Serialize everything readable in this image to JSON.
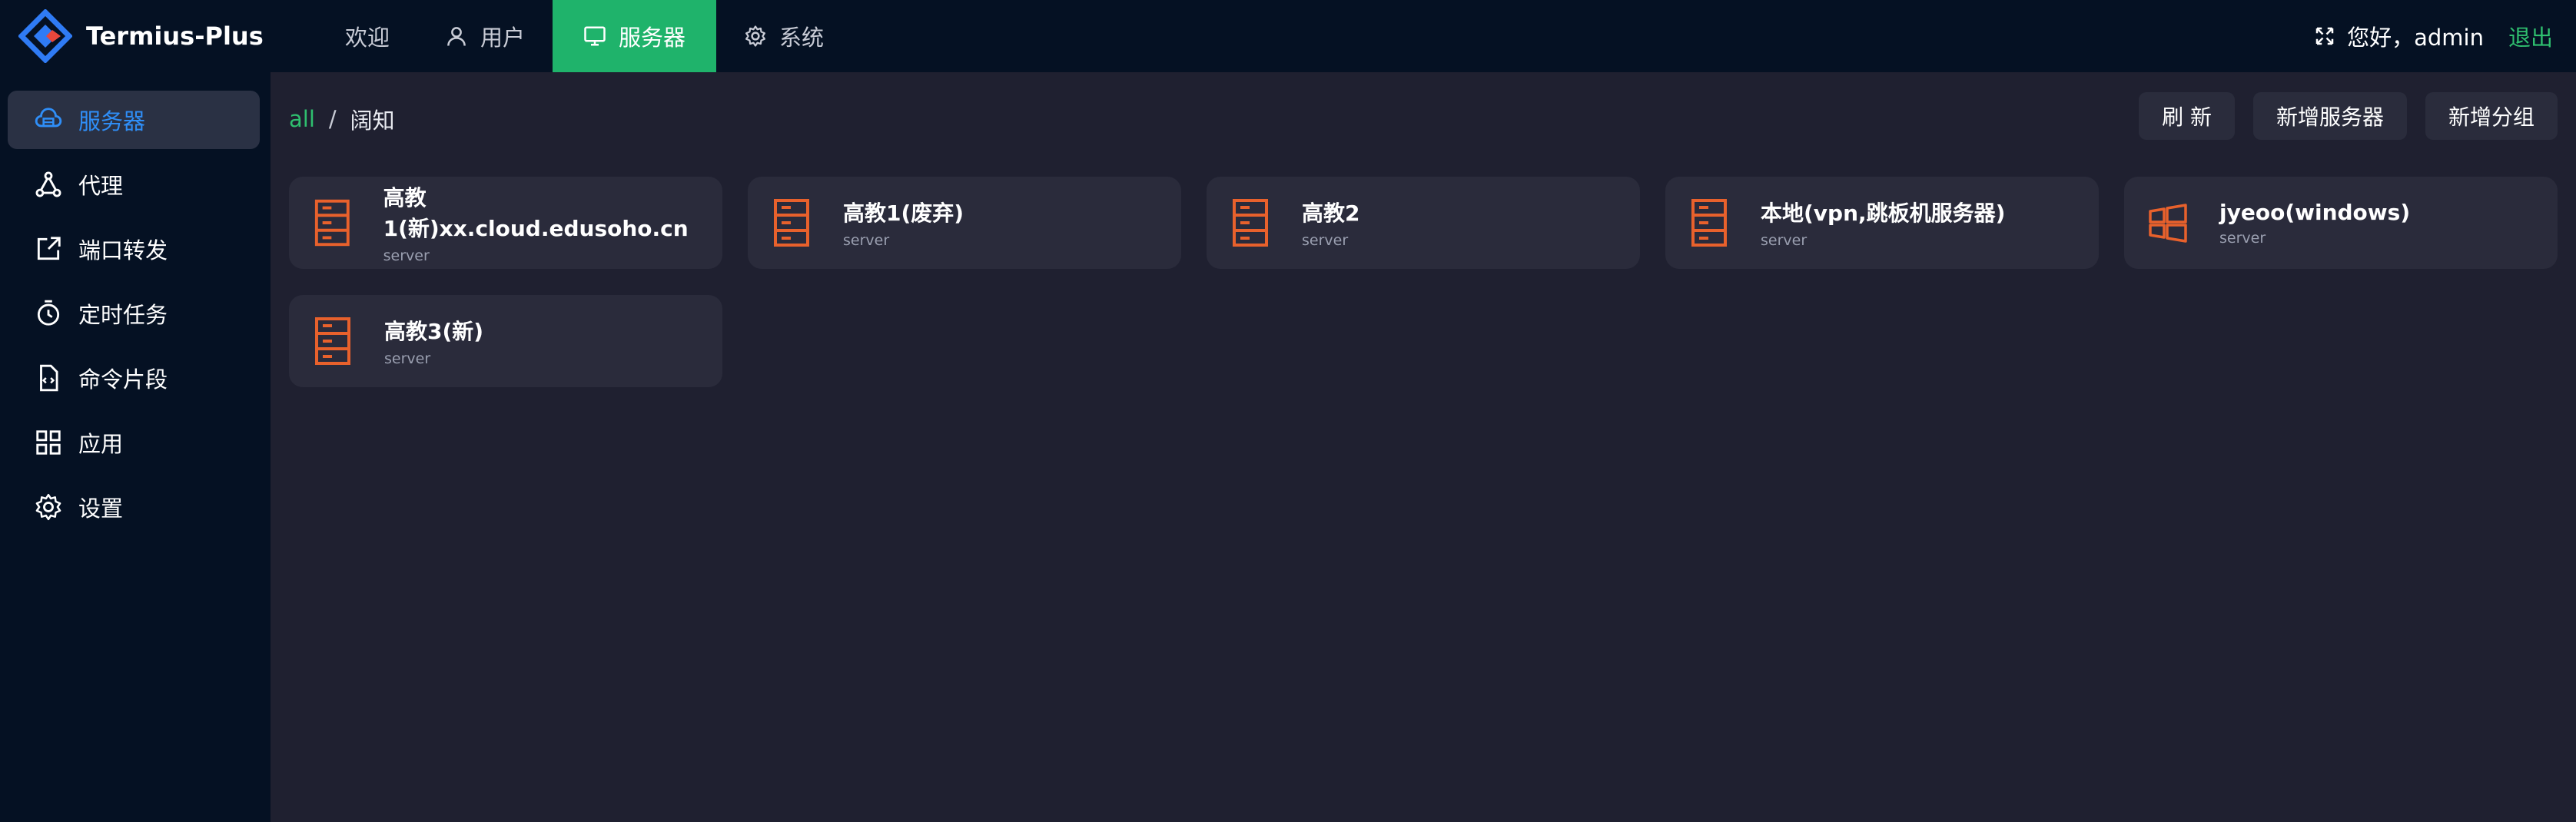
{
  "app": {
    "title": "Termius-Plus"
  },
  "nav": {
    "items": [
      {
        "label": "欢迎",
        "icon": "none"
      },
      {
        "label": "用户",
        "icon": "user-icon"
      },
      {
        "label": "服务器",
        "icon": "monitor-icon",
        "active": true
      },
      {
        "label": "系统",
        "icon": "gear-icon"
      }
    ]
  },
  "header": {
    "greeting": "您好，admin",
    "logout": "退出"
  },
  "sidebar": {
    "items": [
      {
        "label": "服务器",
        "icon": "server-cloud-icon",
        "active": true
      },
      {
        "label": "代理",
        "icon": "network-icon"
      },
      {
        "label": "端口转发",
        "icon": "share-icon"
      },
      {
        "label": "定时任务",
        "icon": "timer-icon"
      },
      {
        "label": "命令片段",
        "icon": "code-file-icon"
      },
      {
        "label": "应用",
        "icon": "grid-icon"
      },
      {
        "label": "设置",
        "icon": "settings-icon"
      }
    ]
  },
  "breadcrumb": {
    "root": "all",
    "separator": "/",
    "current": "阔知"
  },
  "actions": {
    "refresh": "刷 新",
    "add_server": "新增服务器",
    "add_group": "新增分组"
  },
  "servers": [
    {
      "name": "高教1(新)xx.cloud.edusoho.cn",
      "type": "server",
      "icon": "server-icon"
    },
    {
      "name": "高教1(废弃)",
      "type": "server",
      "icon": "server-icon"
    },
    {
      "name": "高教2",
      "type": "server",
      "icon": "server-icon"
    },
    {
      "name": "本地(vpn,跳板机服务器)",
      "type": "server",
      "icon": "server-icon"
    },
    {
      "name": "jyeoo(windows)",
      "type": "server",
      "icon": "windows-icon"
    },
    {
      "name": "高教3(新)",
      "type": "server",
      "icon": "server-icon"
    }
  ],
  "colors": {
    "accent": "#1fb36b",
    "link": "#2fbf6f",
    "active_side": "#2f8ef7",
    "icon": "#e8612c",
    "topbar": "#051123",
    "background": "#1f2030"
  }
}
